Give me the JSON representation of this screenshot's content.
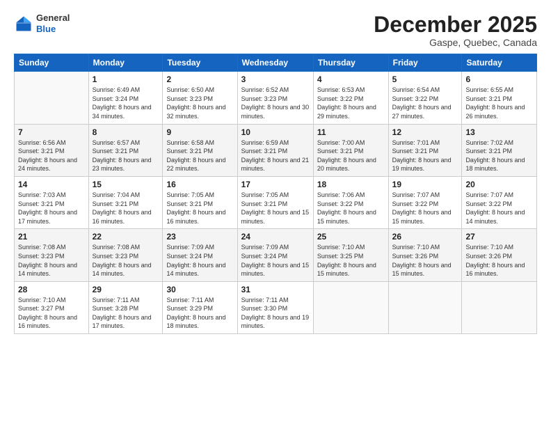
{
  "header": {
    "logo": {
      "general": "General",
      "blue": "Blue"
    },
    "title": "December 2025",
    "location": "Gaspe, Quebec, Canada"
  },
  "weekdays": [
    "Sunday",
    "Monday",
    "Tuesday",
    "Wednesday",
    "Thursday",
    "Friday",
    "Saturday"
  ],
  "weeks": [
    [
      {
        "day": "",
        "sunrise": "",
        "sunset": "",
        "daylight": ""
      },
      {
        "day": "1",
        "sunrise": "Sunrise: 6:49 AM",
        "sunset": "Sunset: 3:24 PM",
        "daylight": "Daylight: 8 hours and 34 minutes."
      },
      {
        "day": "2",
        "sunrise": "Sunrise: 6:50 AM",
        "sunset": "Sunset: 3:23 PM",
        "daylight": "Daylight: 8 hours and 32 minutes."
      },
      {
        "day": "3",
        "sunrise": "Sunrise: 6:52 AM",
        "sunset": "Sunset: 3:23 PM",
        "daylight": "Daylight: 8 hours and 30 minutes."
      },
      {
        "day": "4",
        "sunrise": "Sunrise: 6:53 AM",
        "sunset": "Sunset: 3:22 PM",
        "daylight": "Daylight: 8 hours and 29 minutes."
      },
      {
        "day": "5",
        "sunrise": "Sunrise: 6:54 AM",
        "sunset": "Sunset: 3:22 PM",
        "daylight": "Daylight: 8 hours and 27 minutes."
      },
      {
        "day": "6",
        "sunrise": "Sunrise: 6:55 AM",
        "sunset": "Sunset: 3:21 PM",
        "daylight": "Daylight: 8 hours and 26 minutes."
      }
    ],
    [
      {
        "day": "7",
        "sunrise": "Sunrise: 6:56 AM",
        "sunset": "Sunset: 3:21 PM",
        "daylight": "Daylight: 8 hours and 24 minutes."
      },
      {
        "day": "8",
        "sunrise": "Sunrise: 6:57 AM",
        "sunset": "Sunset: 3:21 PM",
        "daylight": "Daylight: 8 hours and 23 minutes."
      },
      {
        "day": "9",
        "sunrise": "Sunrise: 6:58 AM",
        "sunset": "Sunset: 3:21 PM",
        "daylight": "Daylight: 8 hours and 22 minutes."
      },
      {
        "day": "10",
        "sunrise": "Sunrise: 6:59 AM",
        "sunset": "Sunset: 3:21 PM",
        "daylight": "Daylight: 8 hours and 21 minutes."
      },
      {
        "day": "11",
        "sunrise": "Sunrise: 7:00 AM",
        "sunset": "Sunset: 3:21 PM",
        "daylight": "Daylight: 8 hours and 20 minutes."
      },
      {
        "day": "12",
        "sunrise": "Sunrise: 7:01 AM",
        "sunset": "Sunset: 3:21 PM",
        "daylight": "Daylight: 8 hours and 19 minutes."
      },
      {
        "day": "13",
        "sunrise": "Sunrise: 7:02 AM",
        "sunset": "Sunset: 3:21 PM",
        "daylight": "Daylight: 8 hours and 18 minutes."
      }
    ],
    [
      {
        "day": "14",
        "sunrise": "Sunrise: 7:03 AM",
        "sunset": "Sunset: 3:21 PM",
        "daylight": "Daylight: 8 hours and 17 minutes."
      },
      {
        "day": "15",
        "sunrise": "Sunrise: 7:04 AM",
        "sunset": "Sunset: 3:21 PM",
        "daylight": "Daylight: 8 hours and 16 minutes."
      },
      {
        "day": "16",
        "sunrise": "Sunrise: 7:05 AM",
        "sunset": "Sunset: 3:21 PM",
        "daylight": "Daylight: 8 hours and 16 minutes."
      },
      {
        "day": "17",
        "sunrise": "Sunrise: 7:05 AM",
        "sunset": "Sunset: 3:21 PM",
        "daylight": "Daylight: 8 hours and 15 minutes."
      },
      {
        "day": "18",
        "sunrise": "Sunrise: 7:06 AM",
        "sunset": "Sunset: 3:22 PM",
        "daylight": "Daylight: 8 hours and 15 minutes."
      },
      {
        "day": "19",
        "sunrise": "Sunrise: 7:07 AM",
        "sunset": "Sunset: 3:22 PM",
        "daylight": "Daylight: 8 hours and 15 minutes."
      },
      {
        "day": "20",
        "sunrise": "Sunrise: 7:07 AM",
        "sunset": "Sunset: 3:22 PM",
        "daylight": "Daylight: 8 hours and 14 minutes."
      }
    ],
    [
      {
        "day": "21",
        "sunrise": "Sunrise: 7:08 AM",
        "sunset": "Sunset: 3:23 PM",
        "daylight": "Daylight: 8 hours and 14 minutes."
      },
      {
        "day": "22",
        "sunrise": "Sunrise: 7:08 AM",
        "sunset": "Sunset: 3:23 PM",
        "daylight": "Daylight: 8 hours and 14 minutes."
      },
      {
        "day": "23",
        "sunrise": "Sunrise: 7:09 AM",
        "sunset": "Sunset: 3:24 PM",
        "daylight": "Daylight: 8 hours and 14 minutes."
      },
      {
        "day": "24",
        "sunrise": "Sunrise: 7:09 AM",
        "sunset": "Sunset: 3:24 PM",
        "daylight": "Daylight: 8 hours and 15 minutes."
      },
      {
        "day": "25",
        "sunrise": "Sunrise: 7:10 AM",
        "sunset": "Sunset: 3:25 PM",
        "daylight": "Daylight: 8 hours and 15 minutes."
      },
      {
        "day": "26",
        "sunrise": "Sunrise: 7:10 AM",
        "sunset": "Sunset: 3:26 PM",
        "daylight": "Daylight: 8 hours and 15 minutes."
      },
      {
        "day": "27",
        "sunrise": "Sunrise: 7:10 AM",
        "sunset": "Sunset: 3:26 PM",
        "daylight": "Daylight: 8 hours and 16 minutes."
      }
    ],
    [
      {
        "day": "28",
        "sunrise": "Sunrise: 7:10 AM",
        "sunset": "Sunset: 3:27 PM",
        "daylight": "Daylight: 8 hours and 16 minutes."
      },
      {
        "day": "29",
        "sunrise": "Sunrise: 7:11 AM",
        "sunset": "Sunset: 3:28 PM",
        "daylight": "Daylight: 8 hours and 17 minutes."
      },
      {
        "day": "30",
        "sunrise": "Sunrise: 7:11 AM",
        "sunset": "Sunset: 3:29 PM",
        "daylight": "Daylight: 8 hours and 18 minutes."
      },
      {
        "day": "31",
        "sunrise": "Sunrise: 7:11 AM",
        "sunset": "Sunset: 3:30 PM",
        "daylight": "Daylight: 8 hours and 19 minutes."
      },
      {
        "day": "",
        "sunrise": "",
        "sunset": "",
        "daylight": ""
      },
      {
        "day": "",
        "sunrise": "",
        "sunset": "",
        "daylight": ""
      },
      {
        "day": "",
        "sunrise": "",
        "sunset": "",
        "daylight": ""
      }
    ]
  ]
}
